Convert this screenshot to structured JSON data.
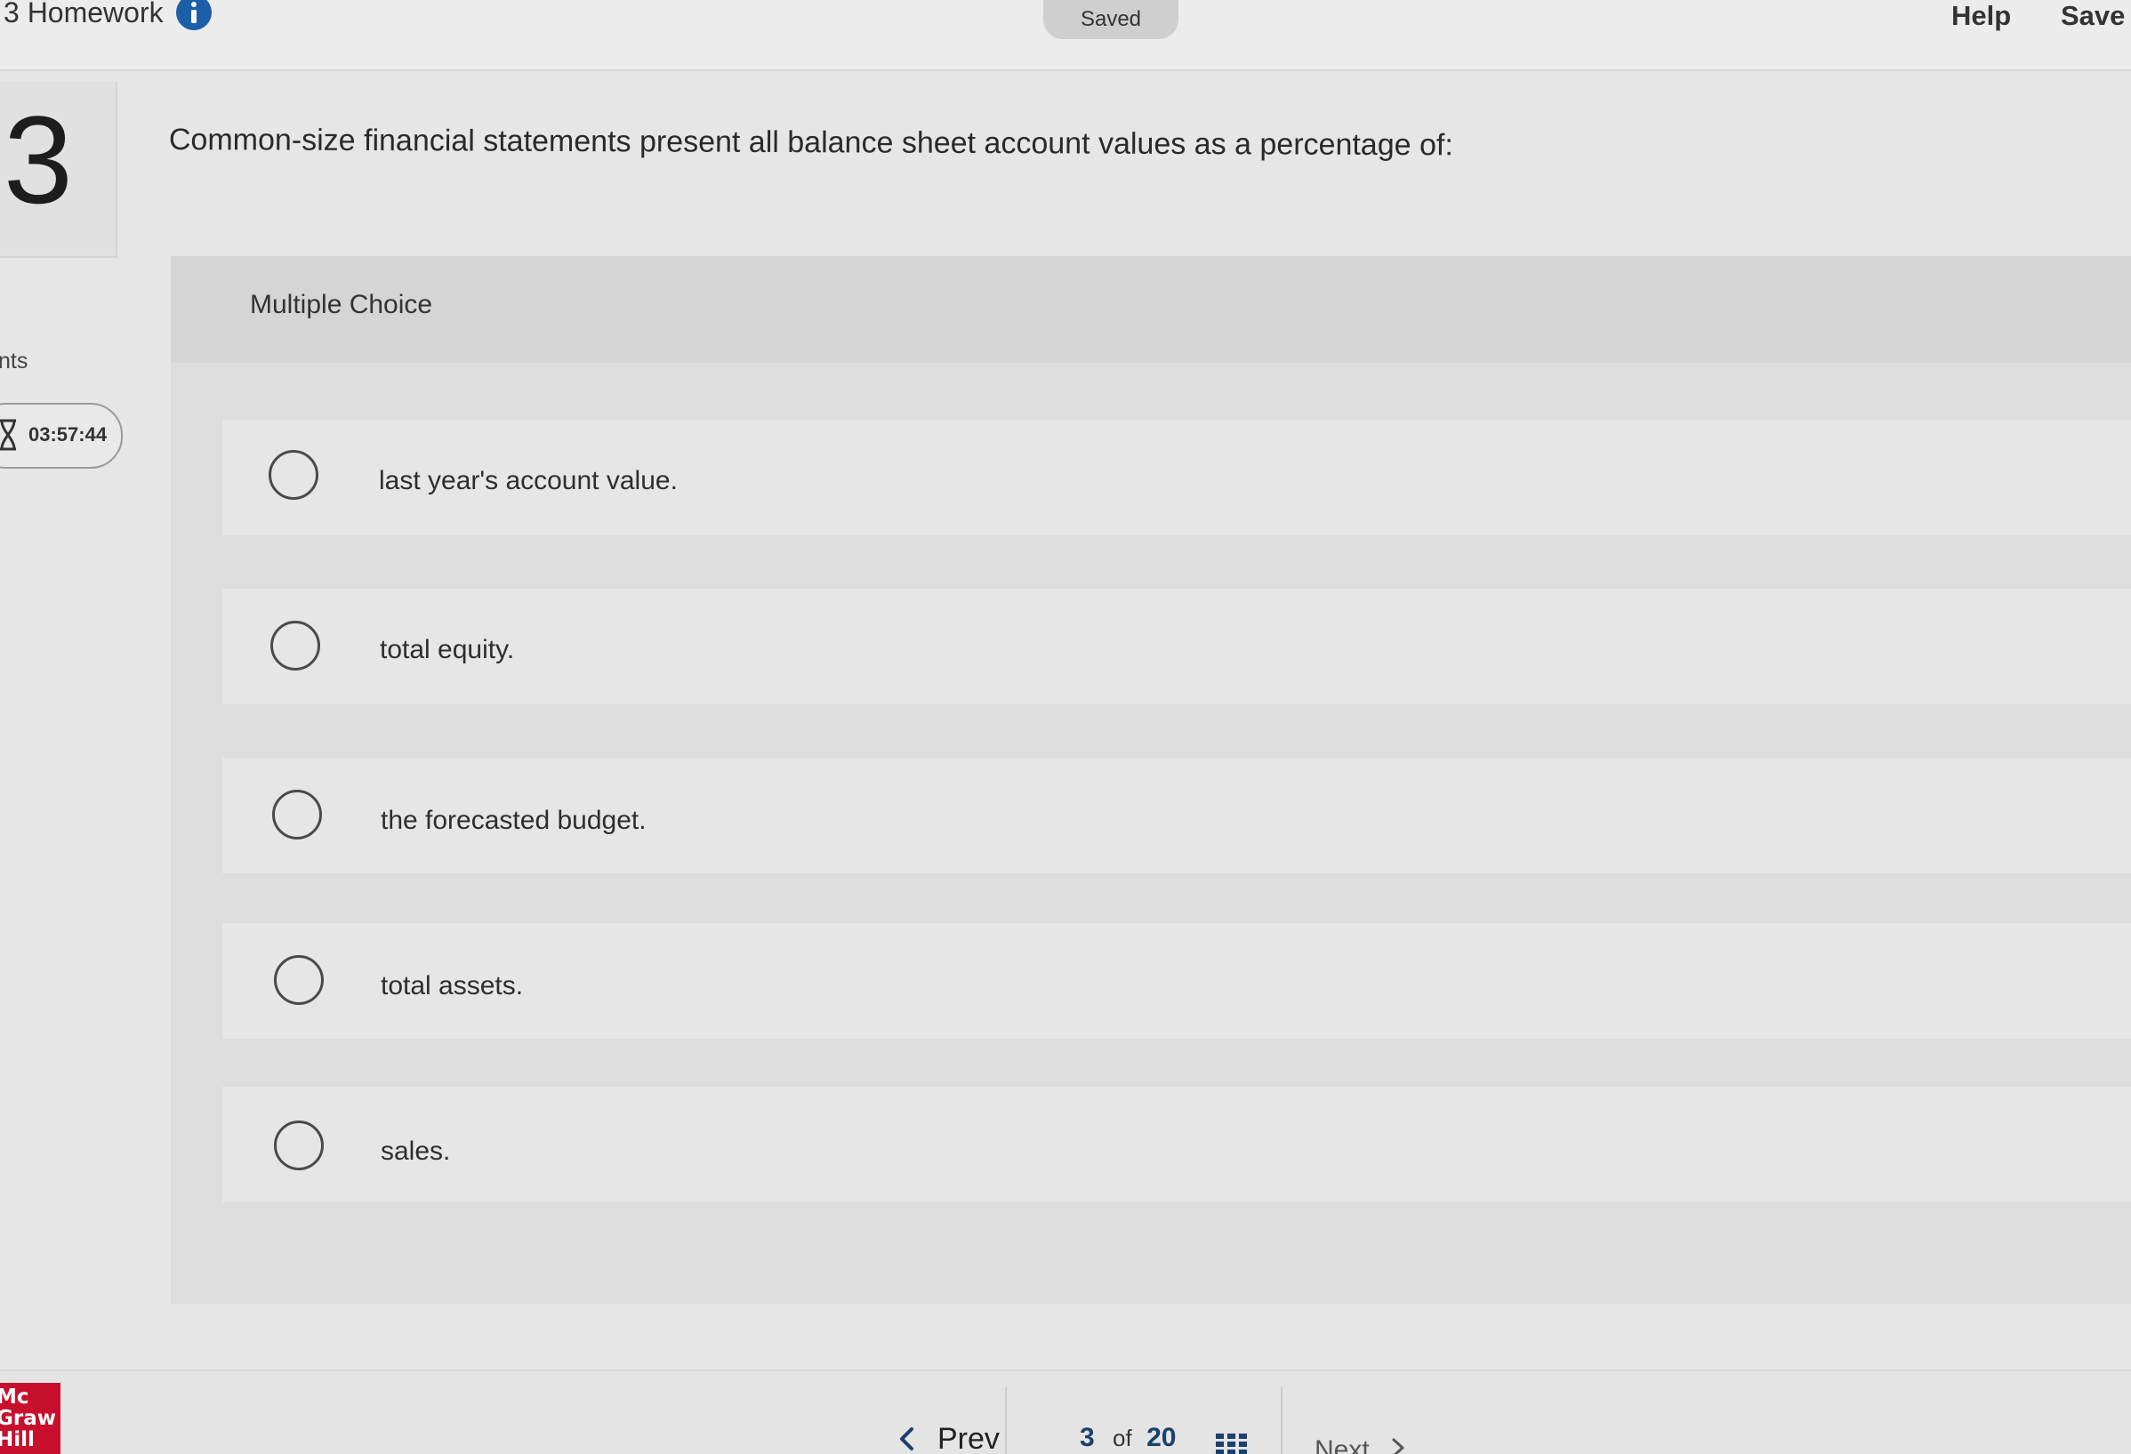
{
  "header": {
    "assignment_title": "3 Homework",
    "saved_status": "Saved",
    "help_label": "Help",
    "save_label": "Save"
  },
  "sidebar": {
    "question_number": "3",
    "points_label": "nts",
    "timer": "03:57:44"
  },
  "question": {
    "prompt": "Common-size financial statements present all balance sheet account values as a percentage of:",
    "type_label": "Multiple Choice",
    "options": [
      "last year's account value.",
      "total equity.",
      "the forecasted budget.",
      "total assets.",
      "sales."
    ]
  },
  "footer": {
    "logo_lines": [
      "Mc",
      "Graw",
      "Hill"
    ],
    "prev_label": "Prev",
    "current_page": "3",
    "of_label": "of",
    "total_pages": "20",
    "next_label": "Next"
  },
  "colors": {
    "brand_red": "#c8102e",
    "info_blue": "#1b5fa8"
  },
  "icons": [
    "info-icon",
    "timer-icon",
    "chevron-left-icon",
    "grid-icon",
    "chevron-right-icon"
  ]
}
